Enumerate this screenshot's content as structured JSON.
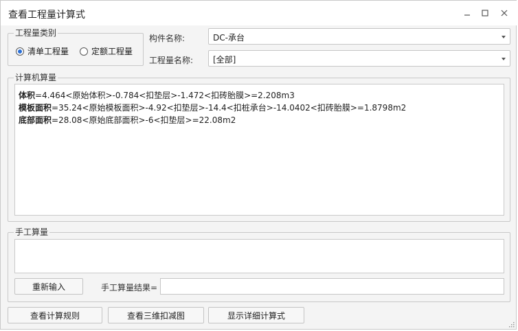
{
  "window": {
    "title": "查看工程量计算式",
    "minimize_icon": "minimize-icon",
    "maximize_icon": "maximize-icon",
    "close_icon": "close-icon"
  },
  "quantity_type": {
    "legend": "工程量类别",
    "options": [
      {
        "label": "清单工程量",
        "checked": true
      },
      {
        "label": "定额工程量",
        "checked": false
      }
    ]
  },
  "component": {
    "label": "构件名称:",
    "value": "DC-承台"
  },
  "quantity_name": {
    "label": "工程量名称:",
    "value": "[全部]"
  },
  "computer_calc": {
    "legend": "计算机算量",
    "lines": [
      {
        "name": "体积",
        "expr": "=4.464<原始体积>-0.784<扣垫层>-1.472<扣砖胎膜>=2.208m3"
      },
      {
        "name": "模板面积",
        "expr": "=35.24<原始模板面积>-4.92<扣垫层>-14.4<扣桩承台>-14.0402<扣砖胎膜>=1.8798m2"
      },
      {
        "name": "底部面积",
        "expr": "=28.08<原始底部面积>-6<扣垫层>=22.08m2"
      }
    ]
  },
  "manual_calc": {
    "legend": "手工算量",
    "reinput_button": "重新输入",
    "result_label": "手工算量结果=",
    "result_value": ""
  },
  "footer": {
    "view_rules_button": "查看计算规则",
    "view_3d_button": "查看三维扣减图",
    "show_detail_button": "显示详细计算式"
  }
}
